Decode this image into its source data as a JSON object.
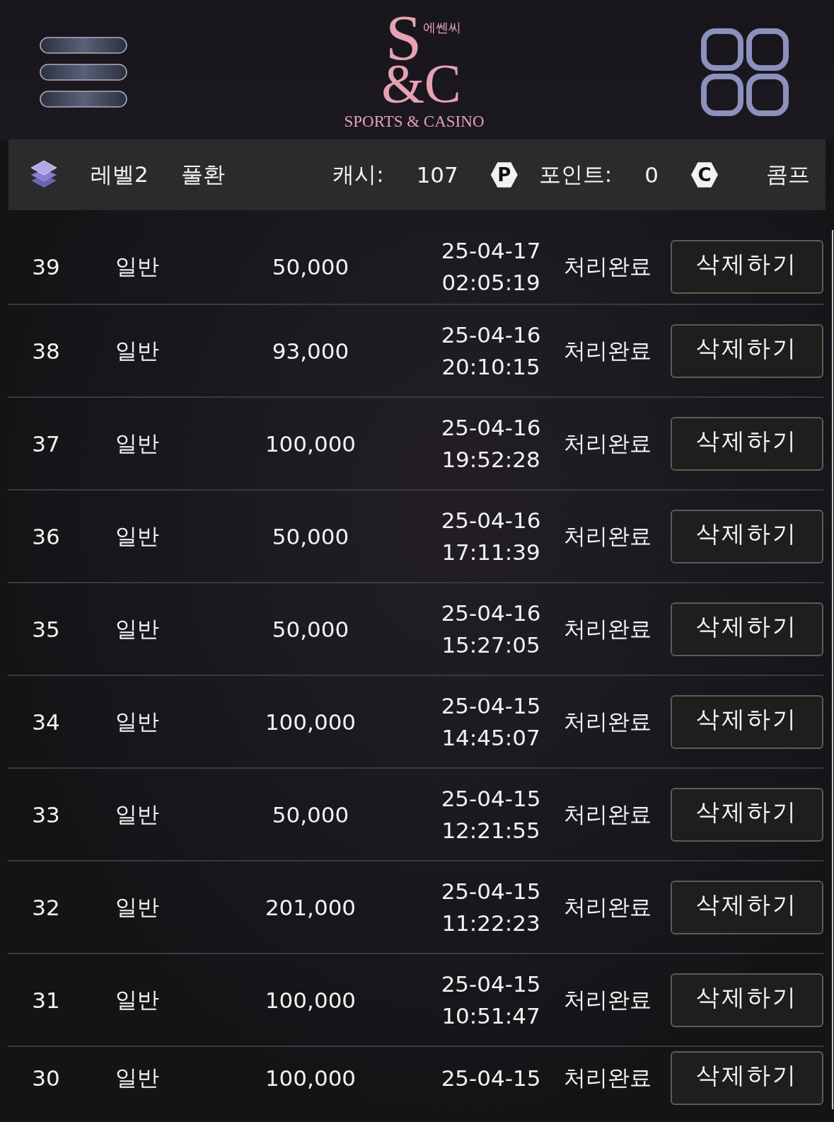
{
  "header": {
    "logo": {
      "top": "S",
      "bottom": "&C",
      "korean": "에쎈씨",
      "tagline": "SPORTS & CASINO"
    }
  },
  "info_bar": {
    "level": "레벨2",
    "mode": "풀환",
    "cash_label": "캐시:",
    "cash": "107",
    "point_badge": "P",
    "points_label": "포인트:",
    "points": "0",
    "comp_badge": "C",
    "comp": "콤프"
  },
  "rows": [
    {
      "number": "39",
      "type": "일반",
      "amount": "50,000",
      "date": "25-04-17",
      "time": "02:05:19",
      "status": "처리완료",
      "action": "삭제하기"
    },
    {
      "number": "38",
      "type": "일반",
      "amount": "93,000",
      "date": "25-04-16",
      "time": "20:10:15",
      "status": "처리완료",
      "action": "삭제하기"
    },
    {
      "number": "37",
      "type": "일반",
      "amount": "100,000",
      "date": "25-04-16",
      "time": "19:52:28",
      "status": "처리완료",
      "action": "삭제하기"
    },
    {
      "number": "36",
      "type": "일반",
      "amount": "50,000",
      "date": "25-04-16",
      "time": "17:11:39",
      "status": "처리완료",
      "action": "삭제하기"
    },
    {
      "number": "35",
      "type": "일반",
      "amount": "50,000",
      "date": "25-04-16",
      "time": "15:27:05",
      "status": "처리완료",
      "action": "삭제하기"
    },
    {
      "number": "34",
      "type": "일반",
      "amount": "100,000",
      "date": "25-04-15",
      "time": "14:45:07",
      "status": "처리완료",
      "action": "삭제하기"
    },
    {
      "number": "33",
      "type": "일반",
      "amount": "50,000",
      "date": "25-04-15",
      "time": "12:21:55",
      "status": "처리완료",
      "action": "삭제하기"
    },
    {
      "number": "32",
      "type": "일반",
      "amount": "201,000",
      "date": "25-04-15",
      "time": "11:22:23",
      "status": "처리완료",
      "action": "삭제하기"
    },
    {
      "number": "31",
      "type": "일반",
      "amount": "100,000",
      "date": "25-04-15",
      "time": "10:51:47",
      "status": "처리완료",
      "action": "삭제하기"
    },
    {
      "number": "30",
      "type": "일반",
      "amount": "100,000",
      "date": "25-04-15",
      "status": "처리완료",
      "action": "삭제하기"
    }
  ]
}
